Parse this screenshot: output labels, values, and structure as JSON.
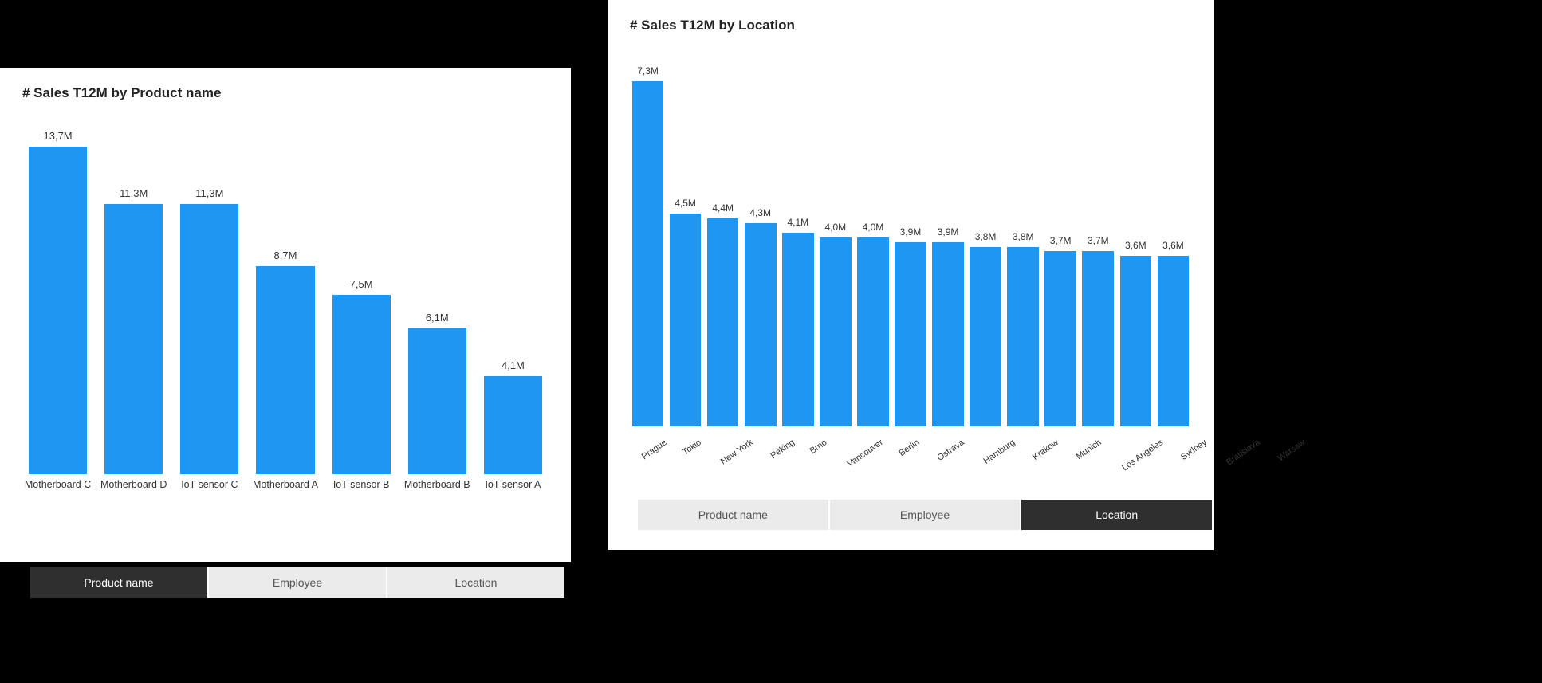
{
  "chart_data": [
    {
      "id": "product",
      "type": "bar",
      "title": "# Sales T12M by Product name",
      "categories": [
        "Motherboard C",
        "Motherboard D",
        "IoT sensor C",
        "Motherboard A",
        "IoT sensor B",
        "Motherboard B",
        "IoT sensor A"
      ],
      "values": [
        13.7,
        11.3,
        11.3,
        8.7,
        7.5,
        6.1,
        4.1
      ],
      "value_labels": [
        "13,7M",
        "11,3M",
        "11,3M",
        "8,7M",
        "7,5M",
        "6,1M",
        "4,1M"
      ],
      "ylim": [
        0,
        14
      ],
      "xlabel": "",
      "ylabel": ""
    },
    {
      "id": "location",
      "type": "bar",
      "title": "# Sales T12M by Location",
      "categories": [
        "Prague",
        "Tokio",
        "New York",
        "Peking",
        "Brno",
        "Vancouver",
        "Berlin",
        "Ostrava",
        "Hamburg",
        "Krakow",
        "Munich",
        "Los Angeles",
        "Sydney",
        "Bratislava",
        "Warsaw"
      ],
      "values": [
        7.3,
        4.5,
        4.4,
        4.3,
        4.1,
        4.0,
        4.0,
        3.9,
        3.9,
        3.8,
        3.8,
        3.7,
        3.7,
        3.6,
        3.6
      ],
      "value_labels": [
        "7,3M",
        "4,5M",
        "4,4M",
        "4,3M",
        "4,1M",
        "4,0M",
        "4,0M",
        "3,9M",
        "3,9M",
        "3,8M",
        "3,8M",
        "3,7M",
        "3,7M",
        "3,6M",
        "3,6M"
      ],
      "ylim": [
        0,
        7.5
      ],
      "xlabel": "",
      "ylabel": ""
    }
  ],
  "tabs": {
    "items": [
      {
        "id": "product",
        "label": "Product name"
      },
      {
        "id": "employee",
        "label": "Employee"
      },
      {
        "id": "location",
        "label": "Location"
      }
    ],
    "active_left": "product",
    "active_right": "location"
  },
  "colors": {
    "bar": "#1e97f3",
    "tab_active_bg": "#2f2f2f",
    "tab_inactive_bg": "#ebebeb"
  }
}
